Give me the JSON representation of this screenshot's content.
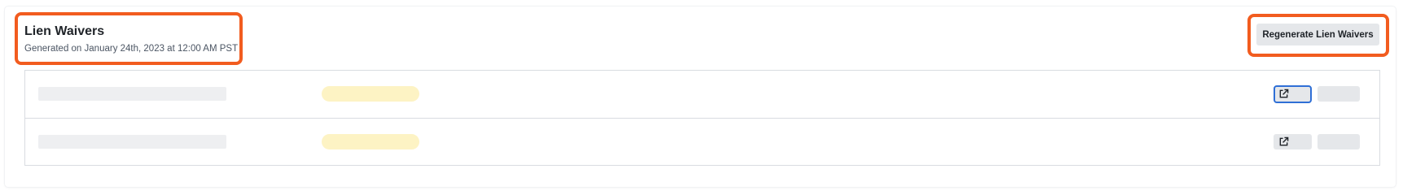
{
  "header": {
    "title": "Lien Waivers",
    "subtitle": "Generated on January 24th, 2023 at 12:00 AM PST",
    "regenerate_label": "Regenerate Lien Waivers"
  },
  "table": {
    "rows": [
      {
        "state": "loading",
        "open_icon": "external-link-icon"
      },
      {
        "state": "loading",
        "open_icon": "external-link-icon"
      }
    ]
  },
  "colors": {
    "highlight": "#f25c1f",
    "focus_ring": "#2f6fd6",
    "skeleton_gray": "#eeeff1",
    "skeleton_yellow": "#fdf3c4",
    "button_bg": "#e5e7ea"
  }
}
